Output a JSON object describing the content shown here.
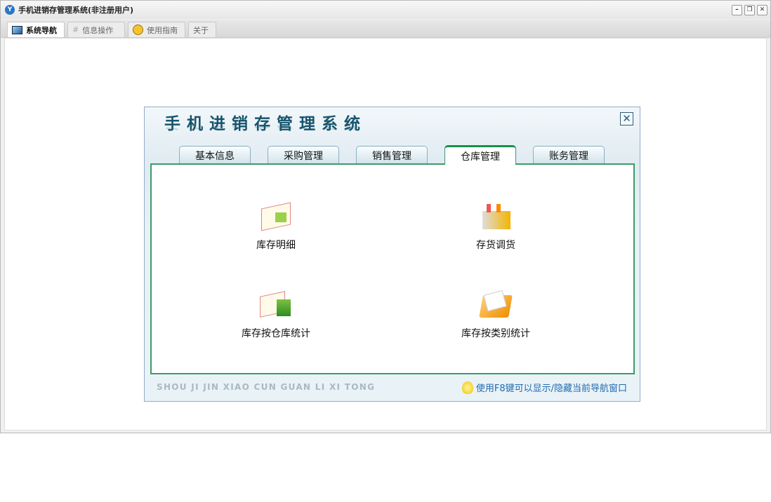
{
  "window": {
    "title": "手机进销存管理系统(非注册用户)",
    "controls": [
      "minimize",
      "restore",
      "close"
    ]
  },
  "tabs": [
    {
      "label": "系统导航",
      "icon": "monitor-icon",
      "active": true
    },
    {
      "label": "信息操作",
      "icon": "grid-icon"
    },
    {
      "label": "使用指南",
      "icon": "help-icon"
    },
    {
      "label": "关于"
    }
  ],
  "dialog": {
    "title": "手机进销存管理系统",
    "tabs": [
      {
        "label": "基本信息"
      },
      {
        "label": "采购管理"
      },
      {
        "label": "销售管理"
      },
      {
        "label": "仓库管理",
        "active": true
      },
      {
        "label": "账务管理"
      }
    ],
    "items": [
      {
        "label": "库存明细",
        "icon": "book-icon"
      },
      {
        "label": "存货调货",
        "icon": "factory-icon"
      },
      {
        "label": "库存按仓库统计",
        "icon": "books-icon"
      },
      {
        "label": "库存按类别统计",
        "icon": "folder-icon"
      }
    ],
    "pinyin": "SHOU JI JIN XIAO CUN GUAN LI XI TONG",
    "hint": "使用F8键可以显示/隐藏当前导航窗口"
  }
}
